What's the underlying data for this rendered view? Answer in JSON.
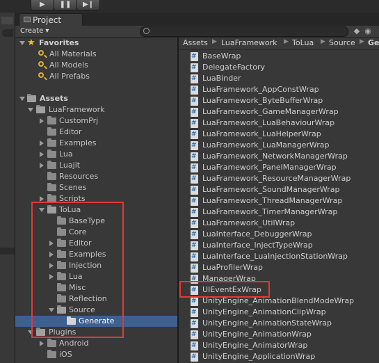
{
  "toolbar": {
    "play_icon": "play-icon",
    "pause_icon": "pause-icon",
    "step_icon": "step-icon"
  },
  "panel": {
    "tab_label": "Project",
    "create_label": "Create ▾"
  },
  "favorites": {
    "header": "Favorites",
    "items": [
      "All Materials",
      "All Models",
      "All Prefabs"
    ]
  },
  "tree": {
    "assets": "Assets",
    "luaframework": "LuaFramework",
    "lf_children": [
      "CustomPrj",
      "Editor",
      "Examples",
      "Lua",
      "Luajit",
      "Resources",
      "Scenes",
      "Scripts"
    ],
    "tolua": "ToLua",
    "tolua_children": [
      "BaseType",
      "Core",
      "Editor",
      "Examples",
      "Injection",
      "Lua",
      "Misc",
      "Reflection"
    ],
    "source": "Source",
    "generate": "Generate",
    "plugins": "Plugins",
    "plugin_children": [
      "Android",
      "iOS"
    ]
  },
  "breadcrumb": [
    "Assets",
    "LuaFramework",
    "ToLua",
    "Source",
    "Ge"
  ],
  "files": [
    "BaseWrap",
    "DelegateFactory",
    "LuaBinder",
    "LuaFramework_AppConstWrap",
    "LuaFramework_ByteBufferWrap",
    "LuaFramework_GameManagerWrap",
    "LuaFramework_LuaBehaviourWrap",
    "LuaFramework_LuaHelperWrap",
    "LuaFramework_LuaManagerWrap",
    "LuaFramework_NetworkManagerWrap",
    "LuaFramework_PanelManagerWrap",
    "LuaFramework_ResourceManagerWrap",
    "LuaFramework_SoundManagerWrap",
    "LuaFramework_ThreadManagerWrap",
    "LuaFramework_TimerManagerWrap",
    "LuaFramework_UtilWrap",
    "LuaInterface_DebuggerWrap",
    "LuaInterface_InjectTypeWrap",
    "LuaInterface_LuaInjectionStationWrap",
    "LuaProfilerWrap",
    "ManagerWrap",
    "UIEventExWrap",
    "UnityEngine_AnimationBlendModeWrap",
    "UnityEngine_AnimationClipWrap",
    "UnityEngine_AnimationStateWrap",
    "UnityEngine_AnimationWrap",
    "UnityEngine_AnimatorWrap",
    "UnityEngine_ApplicationWrap"
  ],
  "colors": {
    "highlight_box": "#e53737",
    "selection": "#3d6091"
  }
}
